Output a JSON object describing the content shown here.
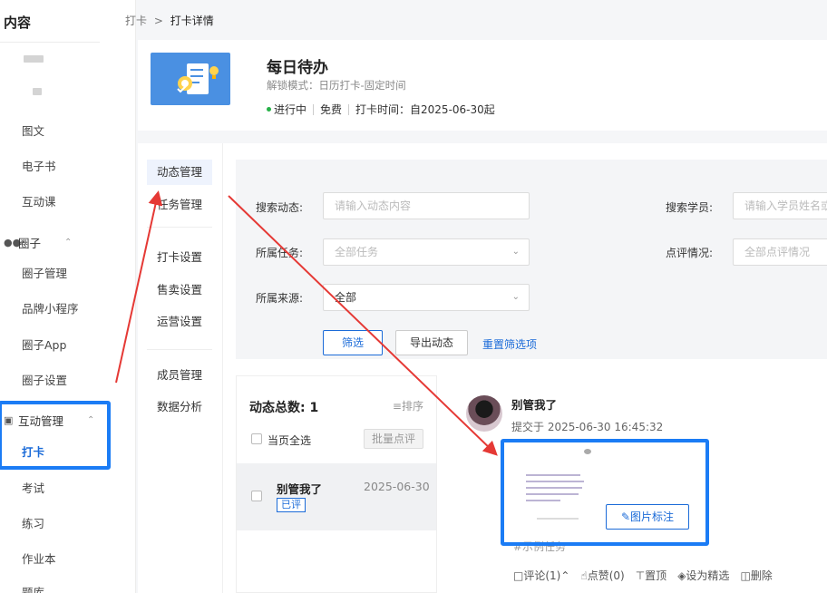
{
  "sidebar": {
    "title": "内容",
    "items": {
      "tuwen": "图文",
      "ebook": "电子书",
      "interactive": "互动课",
      "circle_group": "圈子",
      "circle_manage": "圈子管理",
      "brand_mini": "品牌小程序",
      "circle_app": "圈子App",
      "circle_settings": "圈子设置",
      "interaction_group": "互动管理",
      "checkin": "打卡",
      "exam": "考试",
      "practice": "练习",
      "homework": "作业本",
      "question_bank": "题库"
    }
  },
  "breadcrumb": {
    "parent": "打卡",
    "separator": ">",
    "current": "打卡详情"
  },
  "header": {
    "title": "每日待办",
    "unlock_mode": "解锁模式：日历打卡-固定时间",
    "status": "进行中",
    "price": "免费",
    "time": "打卡时间：自2025-06-30起"
  },
  "subnav": {
    "dynamics": "动态管理",
    "tasks": "任务管理",
    "checkin_settings": "打卡设置",
    "sale_settings": "售卖设置",
    "ops_settings": "运营设置",
    "members": "成员管理",
    "analytics": "数据分析"
  },
  "filter": {
    "search_dynamic_label": "搜索动态:",
    "search_dynamic_placeholder": "请输入动态内容",
    "search_student_label": "搜索学员:",
    "search_student_placeholder": "请输入学员姓名或",
    "task_label": "所属任务:",
    "task_value": "全部任务",
    "review_label": "点评情况:",
    "review_value": "全部点评情况",
    "source_label": "所属来源:",
    "source_value": "全部",
    "filter_btn": "筛选",
    "export_btn": "导出动态",
    "reset_link": "重置筛选项"
  },
  "list": {
    "total_label": "动态总数: 1",
    "sort_label": "排序",
    "select_all": "当页全选",
    "batch_review": "批量点评",
    "row_name": "别管我了",
    "row_date": "2025-06-30",
    "row_tag": "已评"
  },
  "detail": {
    "name": "别管我了",
    "submitted": "提交于 2025-06-30 16:45:32",
    "image_mark_btn": "图片标注",
    "task_tag": "#示例任务",
    "actions": {
      "comment": "评论(1)",
      "like": "点赞(0)",
      "pin": "置顶",
      "featured": "设为精选",
      "delete": "删除"
    }
  },
  "colors": {
    "accent": "#1b6bd8",
    "highlight": "#1b7cf5",
    "arrow": "#e53935",
    "status_green": "#27b148"
  }
}
